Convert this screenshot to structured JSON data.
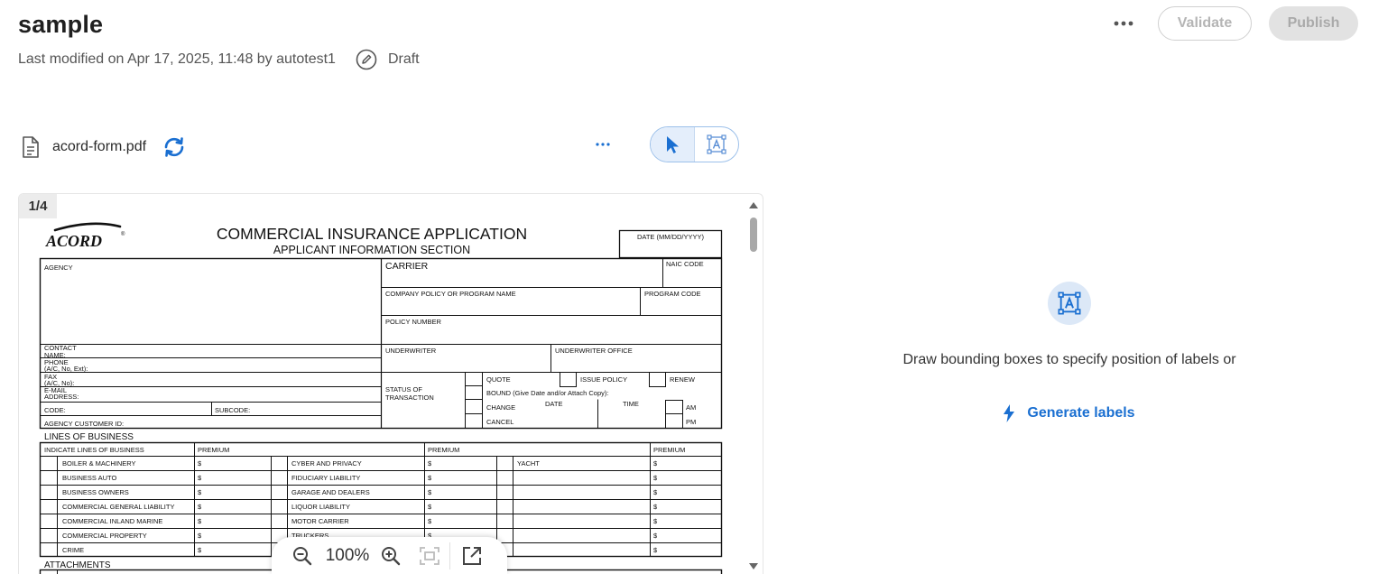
{
  "header": {
    "title": "sample",
    "modified": "Last modified on Apr 17, 2025, 11:48 by autotest1",
    "status": "Draft",
    "validate_label": "Validate",
    "publish_label": "Publish"
  },
  "file": {
    "name": "acord-form.pdf"
  },
  "viewer": {
    "page_indicator": "1/4",
    "zoom": "100%"
  },
  "document": {
    "logo": "ACORD",
    "title": "COMMERCIAL INSURANCE APPLICATION",
    "subtitle": "APPLICANT INFORMATION SECTION",
    "date_label": "DATE (MM/DD/YYYY)",
    "agency": "AGENCY",
    "carrier": "CARRIER",
    "naic_code": "NAIC CODE",
    "company_policy": "COMPANY POLICY OR PROGRAM NAME",
    "program_code": "PROGRAM CODE",
    "policy_number": "POLICY NUMBER",
    "contact_name_1": "CONTACT",
    "contact_name_2": "NAME:",
    "phone_1": "PHONE",
    "phone_2": "(A/C, No, Ext):",
    "fax_1": "FAX",
    "fax_2": "(A/C, No):",
    "email_1": "E-MAIL",
    "email_2": "ADDRESS:",
    "underwriter": "UNDERWRITER",
    "underwriter_office": "UNDERWRITER OFFICE",
    "status_1": "STATUS OF",
    "status_2": "TRANSACTION",
    "quote": "QUOTE",
    "issue_policy": "ISSUE POLICY",
    "renew": "RENEW",
    "bound": "BOUND (Give Date and/or Attach Copy):",
    "change": "CHANGE",
    "date": "DATE",
    "time": "TIME",
    "am": "AM",
    "pm": "PM",
    "cancel": "CANCEL",
    "code": "CODE:",
    "subcode": "SUBCODE:",
    "agency_customer_id": "AGENCY CUSTOMER ID:",
    "lines_heading": "LINES OF BUSINESS",
    "indicate_lines": "INDICATE LINES OF BUSINESS",
    "premium": "PREMIUM",
    "dollar": "$",
    "lines_col1": [
      "BOILER & MACHINERY",
      "BUSINESS AUTO",
      "BUSINESS OWNERS",
      "COMMERCIAL GENERAL LIABILITY",
      "COMMERCIAL INLAND MARINE",
      "COMMERCIAL PROPERTY",
      "CRIME"
    ],
    "lines_col2": [
      "CYBER AND PRIVACY",
      "FIDUCIARY LIABILITY",
      "GARAGE AND DEALERS",
      "LIQUOR LIABILITY",
      "MOTOR CARRIER",
      "TRUCKERS"
    ],
    "lines_col3": [
      "YACHT"
    ],
    "attachments": "ATTACHMENTS"
  },
  "side_panel": {
    "instructions": "Draw bounding boxes to specify position of labels or",
    "generate_label": "Generate labels"
  },
  "colors": {
    "accent": "#1a6fd1",
    "badge_bg": "#ececec",
    "publish_bg": "#e2e2e2"
  }
}
